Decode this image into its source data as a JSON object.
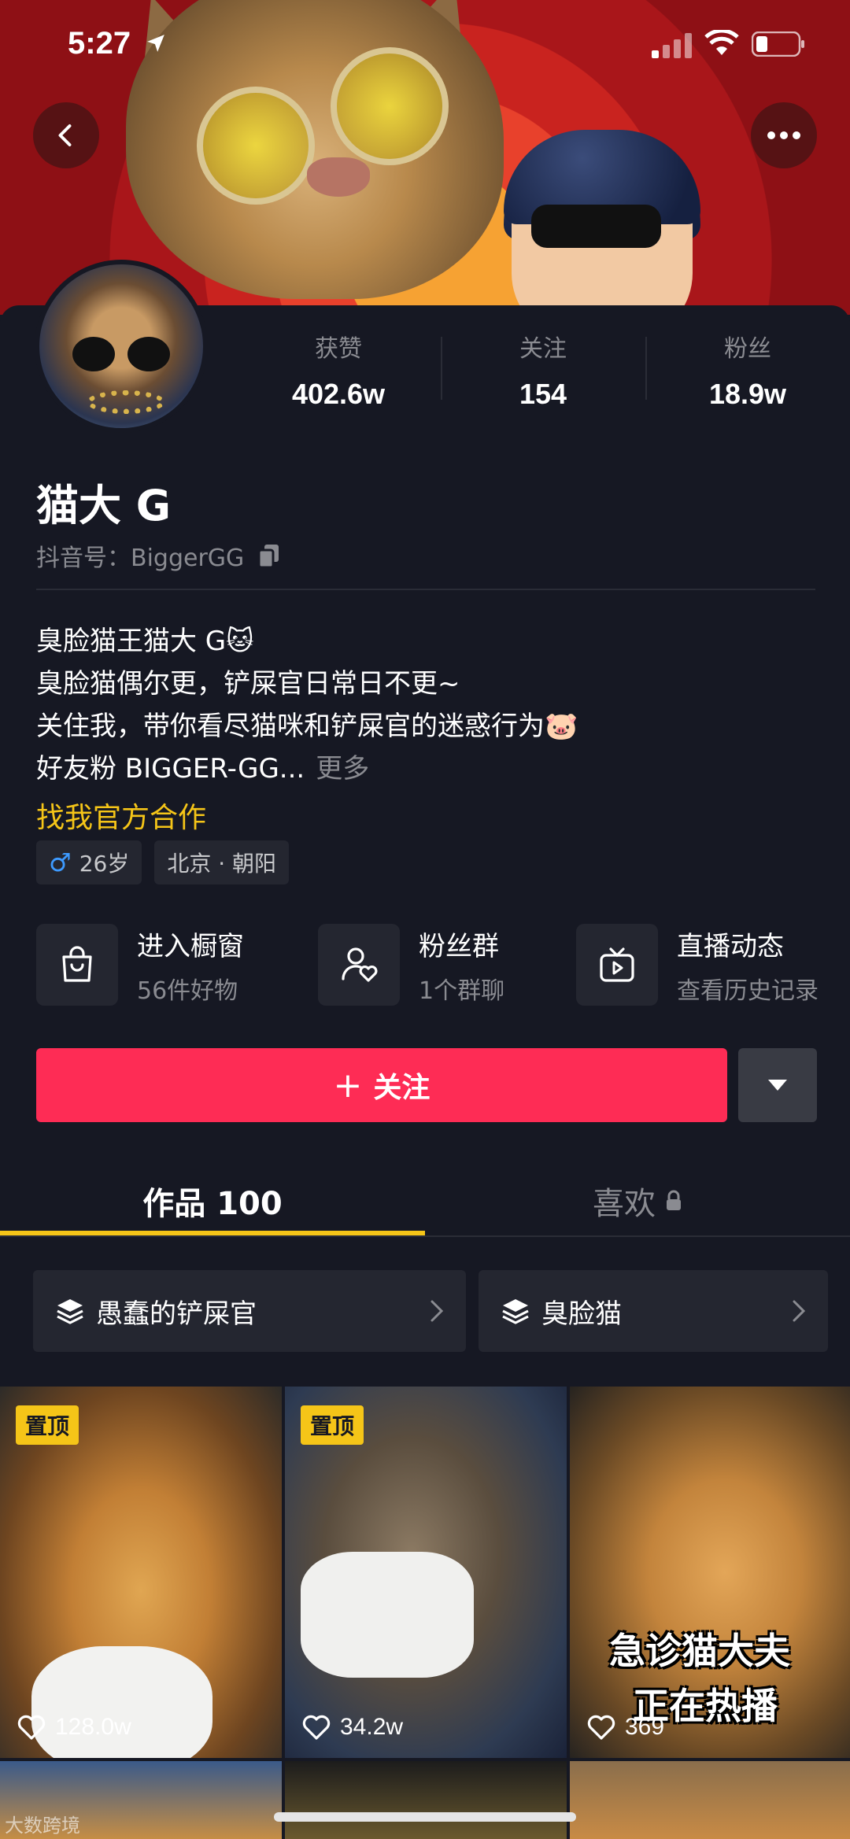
{
  "status_bar": {
    "time": "5:27"
  },
  "profile": {
    "name": "猫大 G",
    "handle_label": "抖音号：",
    "handle": "BiggerGG",
    "stats": [
      {
        "label": "获赞",
        "value": "402.6w"
      },
      {
        "label": "关注",
        "value": "154"
      },
      {
        "label": "粉丝",
        "value": "18.9w"
      }
    ],
    "bio_lines": [
      "臭脸猫王猫大 G🐱",
      "臭脸猫偶尔更，铲屎官日常日不更~",
      "关住我，带你看尽猫咪和铲屎官的迷惑行为🐷",
      "好友粉 BIGGER-GG..."
    ],
    "bio_more": "更多",
    "cooperation_link": "找我官方合作",
    "tags": {
      "gender_symbol": "♂",
      "age": "26岁",
      "location": "北京 · 朝阳"
    }
  },
  "shortcuts": [
    {
      "title": "进入橱窗",
      "subtitle": "56件好物",
      "icon": "shopping-bag-icon"
    },
    {
      "title": "粉丝群",
      "subtitle": "1个群聊",
      "icon": "fan-group-icon"
    },
    {
      "title": "直播动态",
      "subtitle": "查看历史记录",
      "icon": "live-tv-icon"
    }
  ],
  "actions": {
    "follow_label": "关注",
    "follow_plus": "+"
  },
  "tabs": {
    "works": "作品 100",
    "likes": "喜欢"
  },
  "collections": [
    {
      "label": "愚蠢的铲屎官"
    },
    {
      "label": "臭脸猫"
    }
  ],
  "videos": [
    {
      "likes": "128.0w",
      "pinned": true,
      "pin_label": "置顶"
    },
    {
      "likes": "34.2w",
      "pinned": true,
      "pin_label": "置顶"
    },
    {
      "likes": "369",
      "pinned": false,
      "overlay_line1": "急诊猫大夫",
      "overlay_line2": "正在热播"
    }
  ],
  "watermark": "大数跨境",
  "colors": {
    "background": "#161823",
    "follow_button": "#fe2c55",
    "accent_yellow": "#f5c518",
    "muted_text": "#8a8b91"
  }
}
